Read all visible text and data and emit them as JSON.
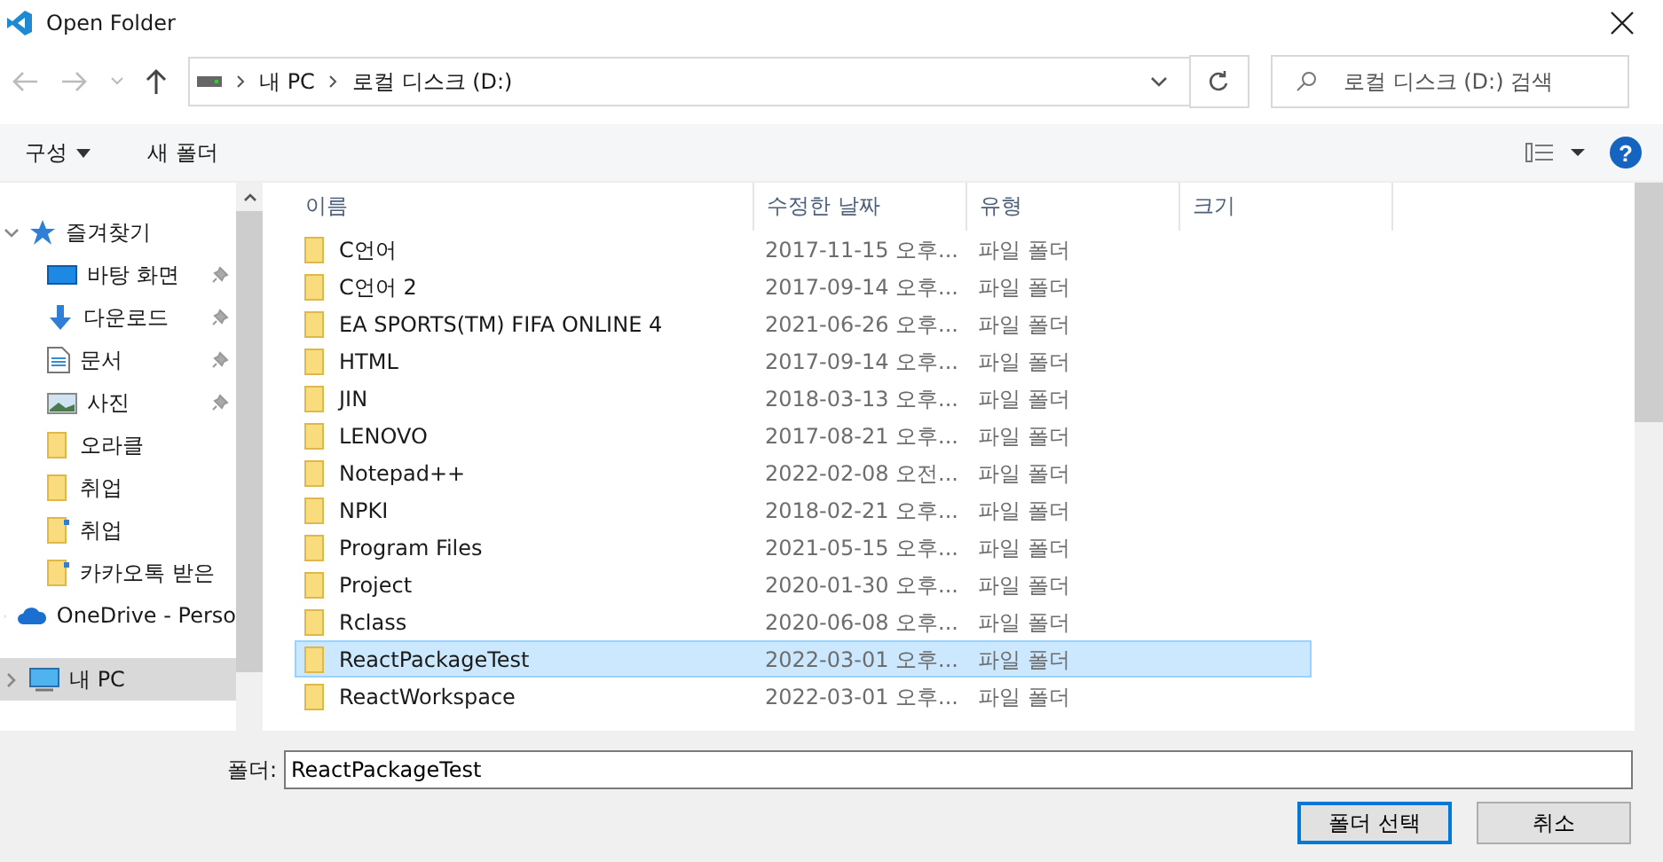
{
  "window": {
    "title": "Open Folder"
  },
  "nav": {
    "path": [
      "내 PC",
      "로컬 디스크 (D:)"
    ],
    "search": {
      "placeholder": "로컬 디스크 (D:) 검색"
    }
  },
  "toolbar": {
    "organize": "구성",
    "new_folder": "새 폴더",
    "help": "?"
  },
  "sidebar": {
    "items": [
      {
        "label": "즐겨찾기",
        "kind": "star",
        "expanded": true,
        "selected": false,
        "children": [
          {
            "label": "바탕 화면",
            "kind": "desktop",
            "pinned": true
          },
          {
            "label": "다운로드",
            "kind": "download",
            "pinned": true
          },
          {
            "label": "문서",
            "kind": "document",
            "pinned": true
          },
          {
            "label": "사진",
            "kind": "picture",
            "pinned": true
          },
          {
            "label": "오라클",
            "kind": "folder",
            "pinned": false
          },
          {
            "label": "취업",
            "kind": "folder",
            "pinned": false
          },
          {
            "label": "취업",
            "kind": "shortcut",
            "pinned": false
          },
          {
            "label": "카카오톡 받은",
            "kind": "shortcut",
            "pinned": false
          }
        ]
      },
      {
        "label": "OneDrive - Perso",
        "kind": "cloud",
        "expanded": false,
        "selected": false
      },
      {
        "label": "내 PC",
        "kind": "pc",
        "expanded": false,
        "selected": true
      }
    ]
  },
  "table": {
    "columns": [
      "이름",
      "수정한 날짜",
      "유형",
      "크기"
    ],
    "rows": [
      {
        "name": "C언어",
        "date": "2017-11-15 오후...",
        "type": "파일 폴더",
        "selected": false
      },
      {
        "name": "C언어 2",
        "date": "2017-09-14 오후...",
        "type": "파일 폴더",
        "selected": false
      },
      {
        "name": "EA SPORTS(TM) FIFA ONLINE 4",
        "date": "2021-06-26 오후...",
        "type": "파일 폴더",
        "selected": false
      },
      {
        "name": "HTML",
        "date": "2017-09-14 오후...",
        "type": "파일 폴더",
        "selected": false
      },
      {
        "name": "JIN",
        "date": "2018-03-13 오후...",
        "type": "파일 폴더",
        "selected": false
      },
      {
        "name": "LENOVO",
        "date": "2017-08-21 오후...",
        "type": "파일 폴더",
        "selected": false
      },
      {
        "name": "Notepad++",
        "date": "2022-02-08 오전...",
        "type": "파일 폴더",
        "selected": false
      },
      {
        "name": "NPKI",
        "date": "2018-02-21 오후...",
        "type": "파일 폴더",
        "selected": false
      },
      {
        "name": "Program Files",
        "date": "2021-05-15 오후...",
        "type": "파일 폴더",
        "selected": false
      },
      {
        "name": "Project",
        "date": "2020-01-30 오후...",
        "type": "파일 폴더",
        "selected": false
      },
      {
        "name": "Rclass",
        "date": "2020-06-08 오후...",
        "type": "파일 폴더",
        "selected": false
      },
      {
        "name": "ReactPackageTest",
        "date": "2022-03-01 오후...",
        "type": "파일 폴더",
        "selected": true
      },
      {
        "name": "ReactWorkspace",
        "date": "2022-03-01 오후...",
        "type": "파일 폴더",
        "selected": false
      }
    ]
  },
  "footer": {
    "folder_label": "폴더:",
    "folder_value": "ReactPackageTest",
    "buttons": [
      "폴더 선택",
      "취소"
    ]
  }
}
